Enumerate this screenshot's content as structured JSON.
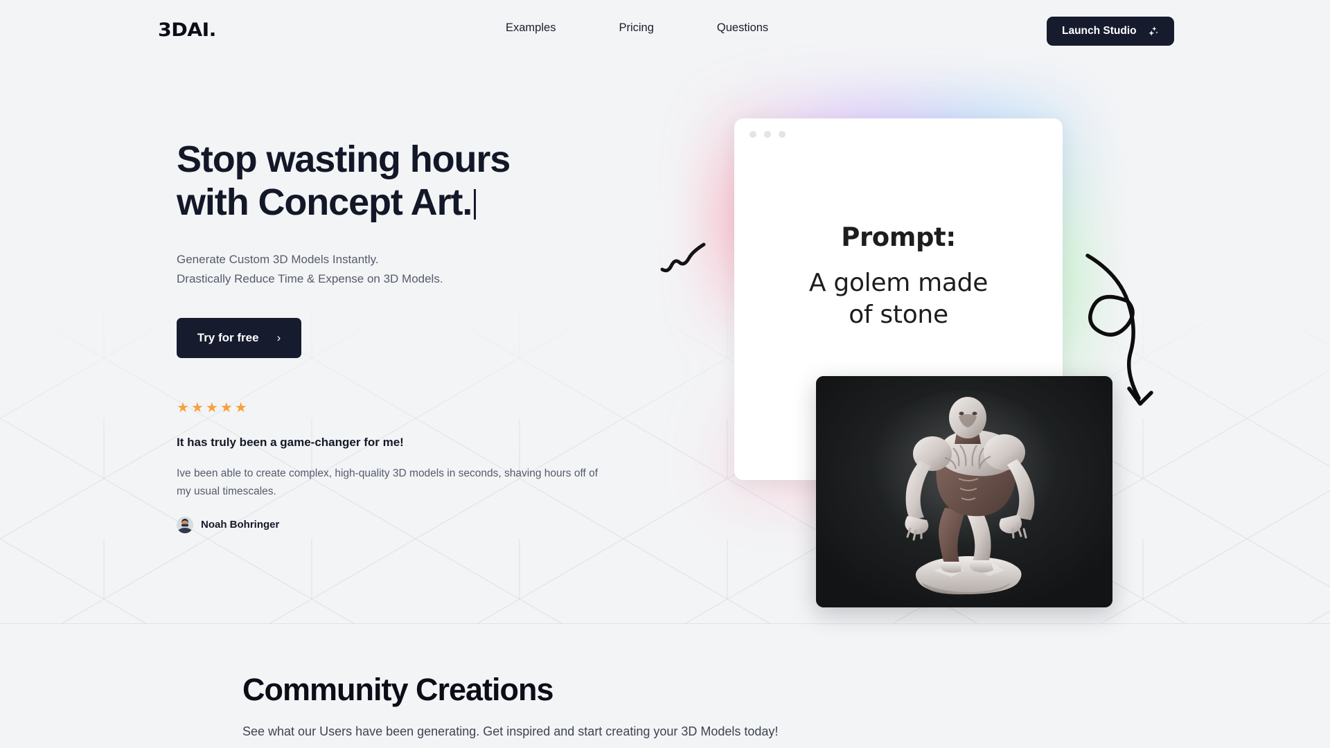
{
  "brand": {
    "logo": "3DAI."
  },
  "nav": {
    "items": [
      {
        "label": "Examples"
      },
      {
        "label": "Pricing"
      },
      {
        "label": "Questions"
      }
    ],
    "cta": {
      "label": "Launch Studio",
      "icon": "sparkles-icon",
      "bg": "#161c2d"
    }
  },
  "hero": {
    "headline_line1": "Stop wasting hours",
    "headline_line2": "with Concept Art.",
    "caret": "|",
    "subtitle_line1": "Generate Custom 3D Models Instantly.",
    "subtitle_line2": "Drastically Reduce Time & Expense on 3D Models.",
    "cta": {
      "label": "Try for free",
      "chevron": "›",
      "bg": "#161c2d"
    }
  },
  "testimonial": {
    "rating": 5,
    "star_glyph": "★",
    "star_color": "#f9a03c",
    "title": "It has truly been a game-changer for me!",
    "body_line1": "Ive been able to create complex, high-quality 3D models in seconds, shaving hours off",
    "body_line2": "of my usual timescales.",
    "author": "Noah Bohringer"
  },
  "preview": {
    "window_dots": 3,
    "prompt_label": "Prompt:",
    "prompt_line1": "A golem made",
    "prompt_line2": "of stone",
    "render_alt": "stone-golem-3d-render",
    "render_bg": "#17191a"
  },
  "community": {
    "title": "Community Creations",
    "subtitle": "See what our Users have been generating. Get inspired and start creating your 3D Models today!"
  },
  "theme": {
    "page_bg": "#f3f4f6",
    "text_dark": "#131828",
    "text_muted": "#545b6b",
    "grid_line": "#d9dbdf"
  }
}
